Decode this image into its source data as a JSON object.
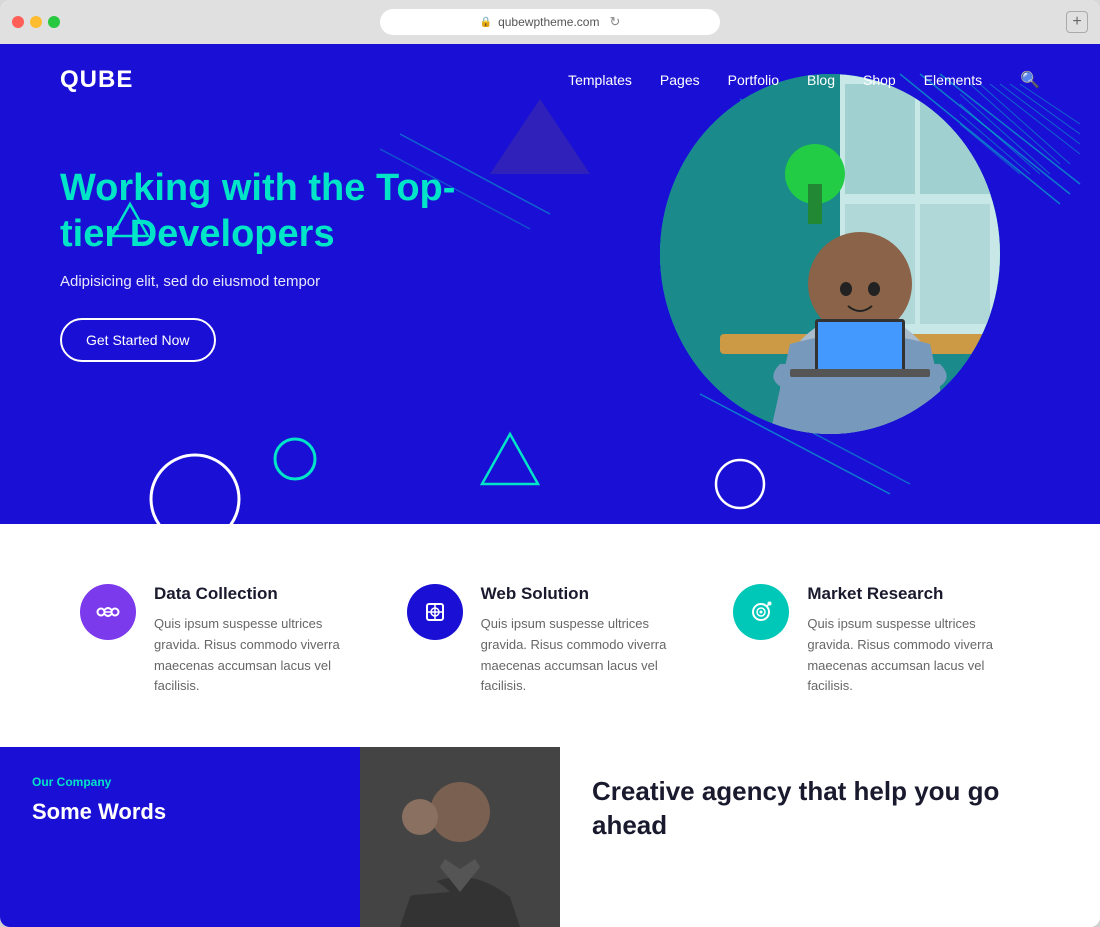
{
  "browser": {
    "url": "qubewptheme.com",
    "new_tab_label": "+"
  },
  "nav": {
    "logo": "QUBE",
    "links": [
      {
        "label": "Templates",
        "id": "templates"
      },
      {
        "label": "Pages",
        "id": "pages"
      },
      {
        "label": "Portfolio",
        "id": "portfolio"
      },
      {
        "label": "Blog",
        "id": "blog"
      },
      {
        "label": "Shop",
        "id": "shop"
      },
      {
        "label": "Elements",
        "id": "elements"
      }
    ]
  },
  "hero": {
    "title": "Working with the Top-tier Developers",
    "subtitle": "Adipisicing elit, sed do eiusmod tempor",
    "cta_label": "Get Started Now"
  },
  "services": [
    {
      "id": "data-collection",
      "title": "Data Collection",
      "description": "Quis ipsum suspesse ultrices gravida. Risus commodo viverra maecenas accumsan lacus vel facilisis.",
      "icon_symbol": "⇆",
      "icon_color": "purple"
    },
    {
      "id": "web-solution",
      "title": "Web Solution",
      "description": "Quis ipsum suspesse ultrices gravida. Risus commodo viverra maecenas accumsan lacus vel facilisis.",
      "icon_symbol": "◈",
      "icon_color": "navy"
    },
    {
      "id": "market-research",
      "title": "Market Research",
      "description": "Quis ipsum suspesse ultrices gravida. Risus commodo viverra maecenas accumsan lacus vel facilisis.",
      "icon_symbol": "◎",
      "icon_color": "cyan"
    }
  ],
  "bottom": {
    "tag": "Our Company",
    "subtitle": "Some Words",
    "heading": "Creative agency that help you go ahead"
  },
  "colors": {
    "brand_blue": "#1a0fd4",
    "brand_cyan": "#00e5c8",
    "purple": "#7c3aed",
    "navy": "#1a0fd4",
    "teal": "#00c8b8"
  }
}
